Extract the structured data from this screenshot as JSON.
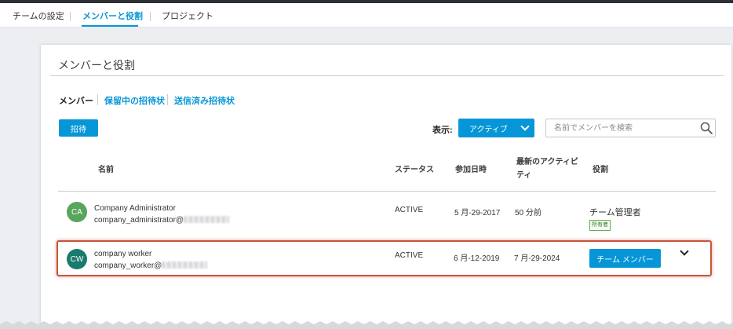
{
  "topnav": {
    "tabs": [
      {
        "label": "チームの設定",
        "active": false
      },
      {
        "label": "メンバーと役割",
        "active": true
      },
      {
        "label": "プロジェクト",
        "active": false
      }
    ]
  },
  "card": {
    "title": "メンバーと役割",
    "subtabs": [
      {
        "label": "メンバー",
        "active": true
      },
      {
        "label": "保留中の招待状",
        "active": false
      },
      {
        "label": "送信済み招待状",
        "active": false
      }
    ],
    "invite_label": "招待",
    "show_label": "表示:",
    "filter_value": "アクティブ",
    "search_placeholder": "名前でメンバーを検索"
  },
  "table": {
    "headers": {
      "name": "名前",
      "status": "ステータス",
      "joined": "参加日時",
      "activity_line1": "最新のアクティビ",
      "activity_line2": "ティ",
      "role": "役割"
    },
    "rows": [
      {
        "initials": "CA",
        "avatar_color": "#58a55c",
        "name": "Company Administrator",
        "email": "company_administrator@",
        "status": "ACTIVE",
        "joined": "5 月-29-2017",
        "activity": "50 分前",
        "role": "チーム管理者",
        "badge": "所有者"
      },
      {
        "initials": "CW",
        "avatar_color": "#1b7a6e",
        "name": "company worker",
        "email": "company_worker@",
        "status": "ACTIVE",
        "joined": "6 月-12-2019",
        "activity": "7 月-29-2024",
        "role": "チーム メンバー"
      }
    ]
  },
  "colors": {
    "accent": "#0696d7",
    "highlight_border": "#c8553a"
  }
}
